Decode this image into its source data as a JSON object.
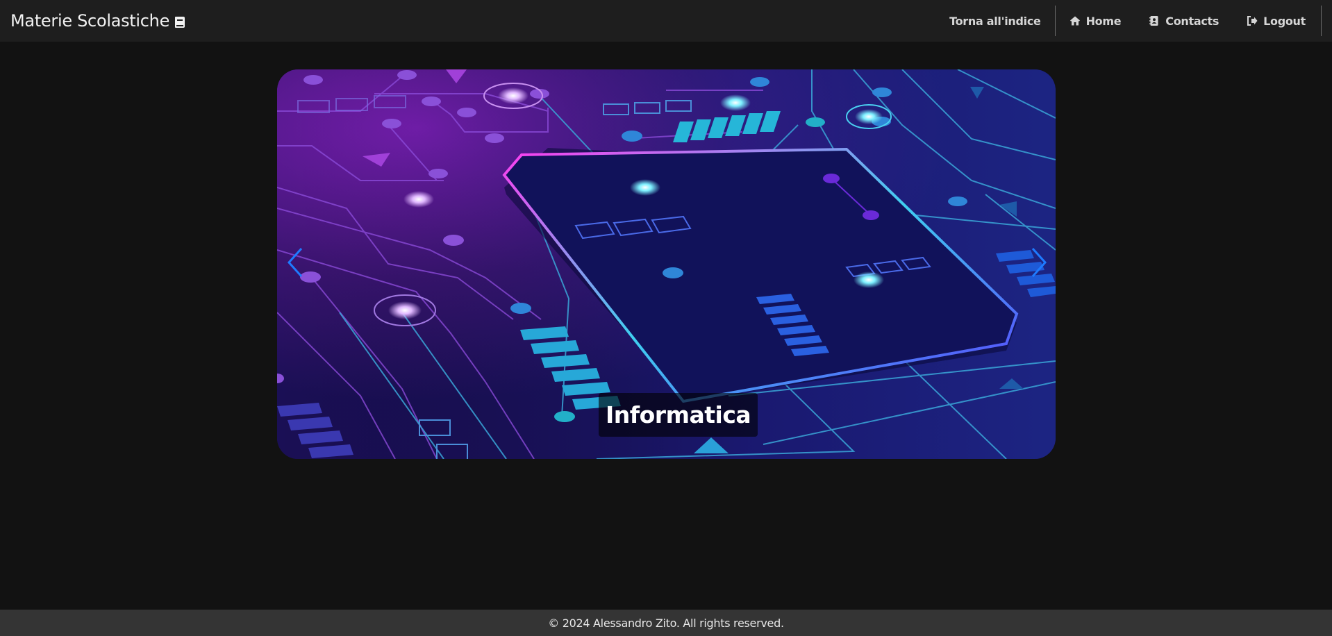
{
  "navbar": {
    "brand_title": "Materie Scolastiche",
    "brand_icon": "book-icon",
    "links": {
      "index": "Torna all'indice",
      "home": "Home",
      "contacts": "Contacts",
      "logout": "Logout"
    },
    "icons": {
      "home": "home-icon",
      "contacts": "address-book-icon",
      "logout": "logout-icon"
    }
  },
  "carousel": {
    "slide_caption": "Informatica",
    "prev_icon": "chevron-left-icon",
    "next_icon": "chevron-right-icon",
    "accent_color": "#1e7bff"
  },
  "footer": {
    "copyright": "© 2024 Alessandro Zito. All rights reserved."
  },
  "colors": {
    "navbar_bg": "#1e1e1e",
    "page_bg": "#121212",
    "footer_bg": "#343434"
  }
}
